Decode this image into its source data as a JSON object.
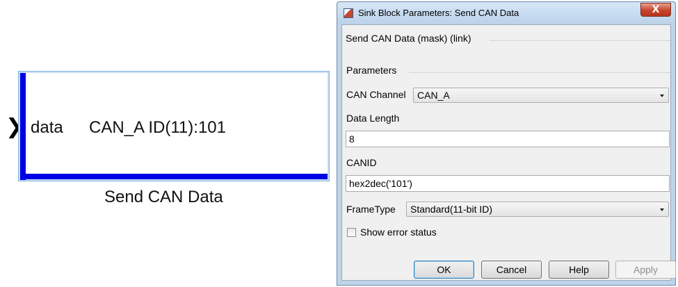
{
  "block": {
    "port_label": "data",
    "param_text": "CAN_A ID(11):101",
    "name": "Send CAN Data",
    "port_icon": "chevron-right-icon",
    "accent_color": "#0000e6"
  },
  "dialog": {
    "title": "Sink Block Parameters: Send CAN Data",
    "close_glyph": "X",
    "description": "Send CAN Data (mask) (link)",
    "parameters_group": "Parameters",
    "can_channel": {
      "label": "CAN Channel",
      "value": "CAN_A"
    },
    "data_length": {
      "label": "Data Length",
      "value": "8"
    },
    "canid": {
      "label": "CANID",
      "value": "hex2dec('101')"
    },
    "frame_type": {
      "label": "FrameType",
      "value": "Standard(11-bit ID)"
    },
    "show_error_status": {
      "label": "Show error status",
      "checked": false
    },
    "buttons": {
      "ok": "OK",
      "cancel": "Cancel",
      "help": "Help",
      "apply": "Apply"
    }
  }
}
